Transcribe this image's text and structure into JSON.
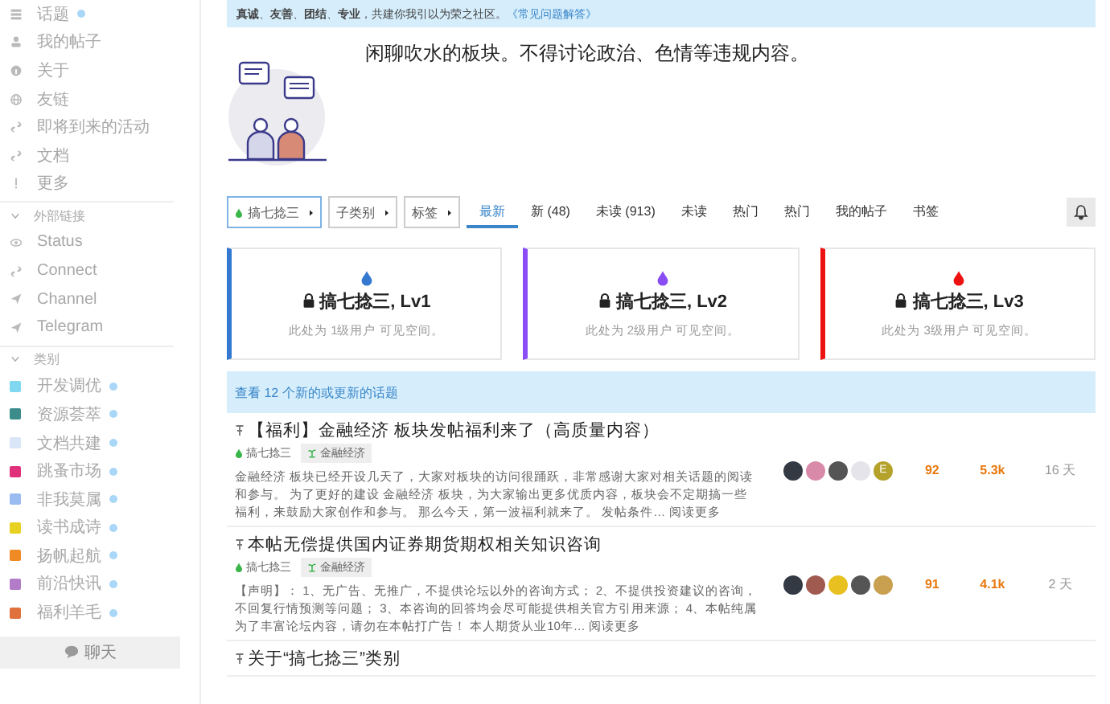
{
  "sidebar": {
    "nav_items": [
      {
        "label": "话题",
        "kind": "topics",
        "unread": true
      },
      {
        "label": "我的帖子",
        "kind": "user",
        "unread": false
      },
      {
        "label": "关于",
        "kind": "info",
        "unread": false
      },
      {
        "label": "友链",
        "kind": "globe",
        "unread": false
      },
      {
        "label": "即将到来的活动",
        "kind": "link",
        "unread": false
      },
      {
        "label": "文档",
        "kind": "link",
        "unread": false
      },
      {
        "label": "更多",
        "kind": "more",
        "unread": false
      }
    ],
    "external_header": {
      "label": "外部链接",
      "expanded": true
    },
    "external_links": [
      {
        "label": "Status",
        "kind": "eye"
      },
      {
        "label": "Connect",
        "kind": "link"
      },
      {
        "label": "Channel",
        "kind": "send"
      },
      {
        "label": "Telegram",
        "kind": "send"
      }
    ],
    "categories_header": {
      "label": "类别",
      "expanded": true
    },
    "categories": [
      {
        "label": "开发调优",
        "color": "#7fd8f0",
        "unread": true
      },
      {
        "label": "资源荟萃",
        "color": "#3c8c8c",
        "unread": true
      },
      {
        "label": "文档共建",
        "color": "#d9e6f7",
        "unread": true
      },
      {
        "label": "跳蚤市场",
        "color": "#e0307a",
        "unread": true
      },
      {
        "label": "非我莫属",
        "color": "#9bbcf0",
        "unread": true
      },
      {
        "label": "读书成诗",
        "color": "#e8d021",
        "unread": true
      },
      {
        "label": "扬帆起航",
        "color": "#f08a24",
        "unread": true
      },
      {
        "label": "前沿快讯",
        "color": "#b27cc9",
        "unread": true
      },
      {
        "label": "福利羊毛",
        "color": "#e0703c",
        "unread": true
      }
    ],
    "chat_button": "聊天"
  },
  "banner": {
    "text": "**真诚**、**友善**、**团结**、**专业**，共建你我引以为荣之社区。",
    "link": "《常见问题解答》"
  },
  "category_description": "闲聊吹水的板块。不得讨论政治、色情等违规内容。",
  "filters": [
    {
      "label": "搞七捻三",
      "kind": "category"
    },
    {
      "label": "子类别",
      "kind": "plain"
    },
    {
      "label": "标签",
      "kind": "plain"
    }
  ],
  "tabs": [
    {
      "label": "最新",
      "selected": true
    },
    {
      "label": "新 (48)",
      "selected": false
    },
    {
      "label": "未读 (913)",
      "selected": false
    },
    {
      "label": "未读",
      "selected": false
    },
    {
      "label": "热门",
      "selected": false
    },
    {
      "label": "热门",
      "selected": false
    },
    {
      "label": "我的帖子",
      "selected": false
    },
    {
      "label": "书签",
      "selected": false
    }
  ],
  "level_cards": [
    {
      "title": "搞七捻三, Lv1",
      "subtitle": "此处为 1级用户 可见空间。",
      "color": "#3478d0"
    },
    {
      "title": "搞七捻三, Lv2",
      "subtitle": "此处为 2级用户 可见空间。",
      "color": "#8a4cf5"
    },
    {
      "title": "搞七捻三, Lv3",
      "subtitle": "此处为 3级用户 可见空间。",
      "color": "#ee1111"
    }
  ],
  "new_topics_notice": "查看 12 个新的或更新的话题",
  "topics": [
    {
      "title": "【福利】金融经济 板块发帖福利来了（高质量内容）",
      "pinned": true,
      "category": "搞七捻三",
      "tag": "金融经济",
      "excerpt": "金融经济 板块已经开设几天了，大家对板块的访问很踊跃，非常感谢大家对相关话题的阅读和参与。 为了更好的建设 金融经济 板块，为大家输出更多优质内容，板块会不定期搞一些福利，来鼓励大家创作和参与。 那么今天，第一波福利就来了。 发帖条件… 阅读更多",
      "posters": [
        {
          "kind": "photo",
          "color": "#333a44"
        },
        {
          "kind": "photo",
          "color": "#d98aa8"
        },
        {
          "kind": "photo",
          "color": "#555555"
        },
        {
          "kind": "photo",
          "color": "#e4e4ea"
        },
        {
          "kind": "letter",
          "letter": "E",
          "color": "#b5a22a"
        }
      ],
      "replies": "92",
      "views": "5.3k",
      "age": "16 天"
    },
    {
      "title": "本帖无偿提供国内证券期货期权相关知识咨询",
      "pinned": true,
      "category": "搞七捻三",
      "tag": "金融经济",
      "excerpt": "【声明】： 1、无广告、无推广，不提供论坛以外的咨询方式； 2、不提供投资建议的咨询，不回复行情预测等问题； 3、本咨询的回答均会尽可能提供相关官方引用来源； 4、本帖纯属为了丰富论坛内容，请勿在本帖打广告！ 本人期货从业10年… 阅读更多",
      "posters": [
        {
          "kind": "photo",
          "color": "#333a44"
        },
        {
          "kind": "photo",
          "color": "#a05a50"
        },
        {
          "kind": "photo",
          "color": "#e8c020"
        },
        {
          "kind": "photo",
          "color": "#555555"
        },
        {
          "kind": "photo",
          "color": "#c8a050"
        }
      ],
      "replies": "91",
      "views": "4.1k",
      "age": "2 天"
    },
    {
      "title": "关于“搞七捻三”类别",
      "pinned": true
    }
  ]
}
